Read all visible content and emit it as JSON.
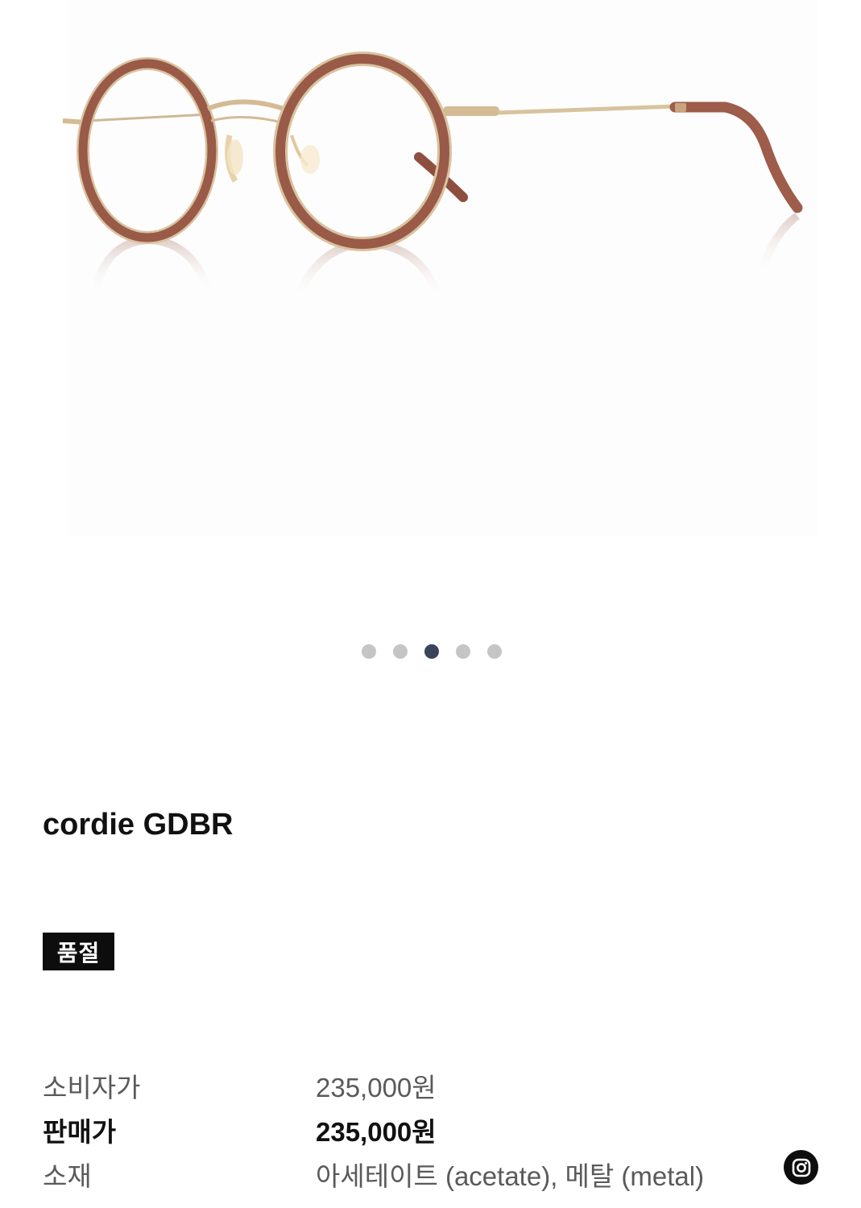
{
  "product": {
    "name": "cordie GDBR",
    "badge": "품절"
  },
  "gallery": {
    "image": "round brown acetate and gold metal eyeglasses",
    "dots_total": 5,
    "active_dot_index": 2
  },
  "info": [
    {
      "label": "소비자가",
      "value": "235,000원",
      "emphasis": false
    },
    {
      "label": "판매가",
      "value": "235,000원",
      "emphasis": true
    },
    {
      "label": "소재",
      "value": "아세테이트 (acetate), 메탈 (metal)",
      "emphasis": false
    }
  ],
  "icons": {
    "share": "instagram-icon"
  },
  "colors": {
    "active_dot": "#3b4559",
    "inactive_dot": "#c5c5c5",
    "badge_bg": "#0d0d0d",
    "frame_brown": "#9a5a48",
    "frame_gold": "#d4bb95"
  }
}
